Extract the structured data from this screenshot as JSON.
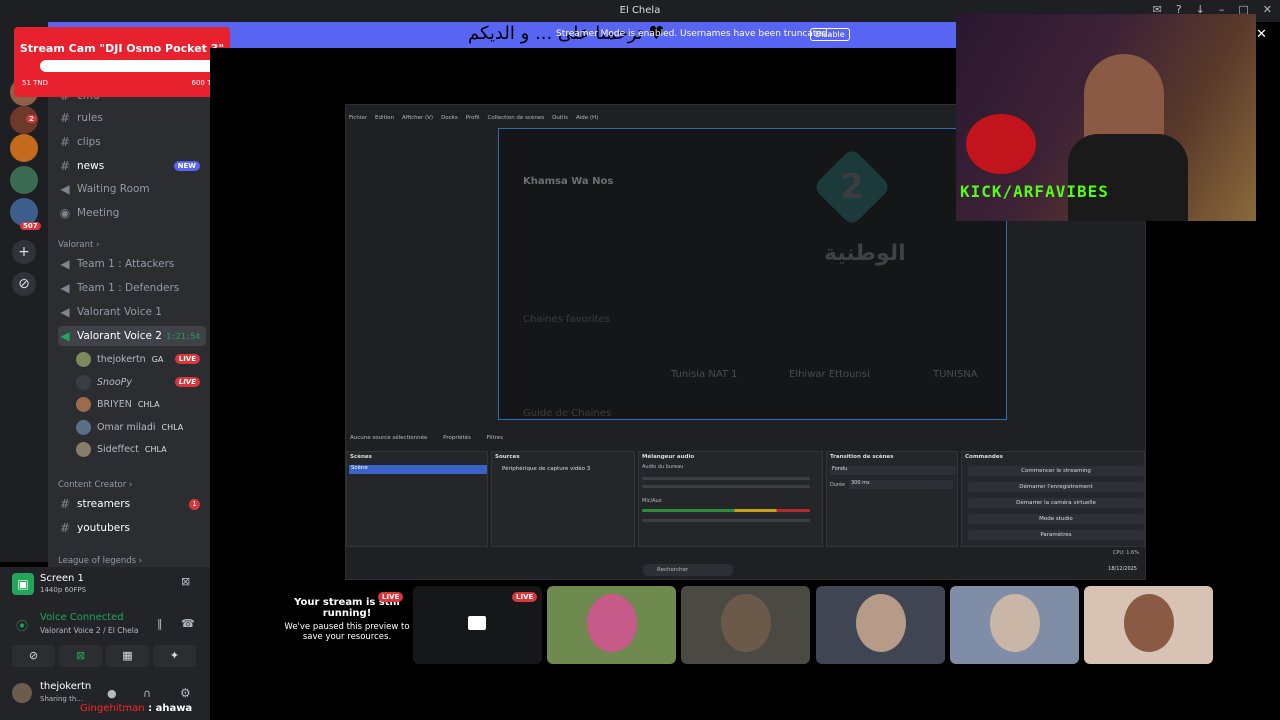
{
  "window": {
    "title": "El Chela"
  },
  "streamer_bar": {
    "message": "Streamer Mode is enabled. Usernames have been truncated.",
    "disable_label": "Disable",
    "overlay_text": "ترحمنا على ... و الديكم ♥"
  },
  "cam_goal": {
    "title": "Stream Cam \"DJI Osmo Pocket 3\"",
    "current": "51 TND",
    "target": "600 TND",
    "progress": 0.085
  },
  "rail": {
    "badges": [
      "2",
      "507"
    ]
  },
  "channels": {
    "top_partial": "cmd",
    "text": [
      {
        "label": "rules"
      },
      {
        "label": "clips"
      },
      {
        "label": "news",
        "badge": "NEW"
      }
    ],
    "voice_misc": [
      {
        "label": "Waiting Room"
      },
      {
        "label": "Meeting"
      }
    ],
    "valorant_category": "Valorant",
    "valorant": [
      {
        "label": "Team 1 : Attackers"
      },
      {
        "label": "Team 1 : Defenders"
      },
      {
        "label": "Valorant Voice 1"
      },
      {
        "label": "Valorant Voice 2",
        "timer": "1:21:54"
      }
    ],
    "voice_users": [
      {
        "name": "thejokertn",
        "tag": "GA",
        "live": "LIVE"
      },
      {
        "name": "SnooPy",
        "tag": "",
        "live": "LIVE"
      },
      {
        "name": "BRIYEN",
        "tag": "CHLA",
        "live": ""
      },
      {
        "name": "Omar miladi",
        "tag": "CHLA",
        "live": ""
      },
      {
        "name": "Sideffect",
        "tag": "CHLA",
        "live": ""
      }
    ],
    "content_category": "Content Creator",
    "content": [
      {
        "label": "streamers",
        "badge": "1"
      },
      {
        "label": "youtubers"
      }
    ],
    "league_category": "League of legends"
  },
  "voice_panel": {
    "screen_title": "Screen 1",
    "screen_sub": "1440p 60FPS",
    "voice_connected": "Voice Connected",
    "voice_channel": "Valorant Voice 2 / El Chela",
    "username": "thejokertn",
    "user_status": "Sharing th..."
  },
  "chat": {
    "name": "Gingehitman",
    "text": ": ahawa"
  },
  "obs": {
    "menu": [
      "Fichier",
      "Edition",
      "Afficher (V)",
      "Docks",
      "Profil",
      "Collection de scènes",
      "Outils",
      "Aide (H)"
    ],
    "program_title": "Khamsa Wa Nos",
    "program_logo_text": "الوطنية",
    "favorites_label": "Chaines favorites",
    "guide_label": "Guide de Chaines",
    "channels": [
      "Tunisia NAT 1",
      "Elhiwar Ettounsi",
      "TUNISNA"
    ],
    "source_bar": {
      "no_source": "Aucune source sélectionnée",
      "properties": "Propriétés",
      "filters": "Filtres"
    },
    "docks": {
      "scenes": "Scènes",
      "scene_item": "Scène",
      "sources": "Sources",
      "source_item": "Périphérique de capture vidéo 3",
      "mixer": "Mélangeur audio",
      "mixer_ch1": "Audio du bureau",
      "mixer_ch2": "Mic/Aux",
      "transitions": "Transition de scènes",
      "transition_value": "Fondu",
      "duration_label": "Durée",
      "duration_value": "300 ms",
      "controls": "Commandes",
      "buttons": [
        "Commencer le streaming",
        "Démarrer l'enregistrement",
        "Démarrer la caméra virtuelle",
        "Mode studio",
        "Paramètres"
      ]
    },
    "status": "CPU: 1.6%",
    "taskbar_search": "Rechercher",
    "taskbar_date": "18/12/2025"
  },
  "webcam": {
    "overlay": "KICK/ARFAVIBES"
  },
  "tiles": {
    "paused_title": "Your stream is still running!",
    "paused_body": "We've paused this preview to save your resources.",
    "live_label": "LIVE"
  },
  "colors": {
    "discord_blurple": "#5865f2",
    "live_red": "#da373c",
    "kick_green": "#53fc18",
    "obs_selection": "#2c6cb3"
  }
}
